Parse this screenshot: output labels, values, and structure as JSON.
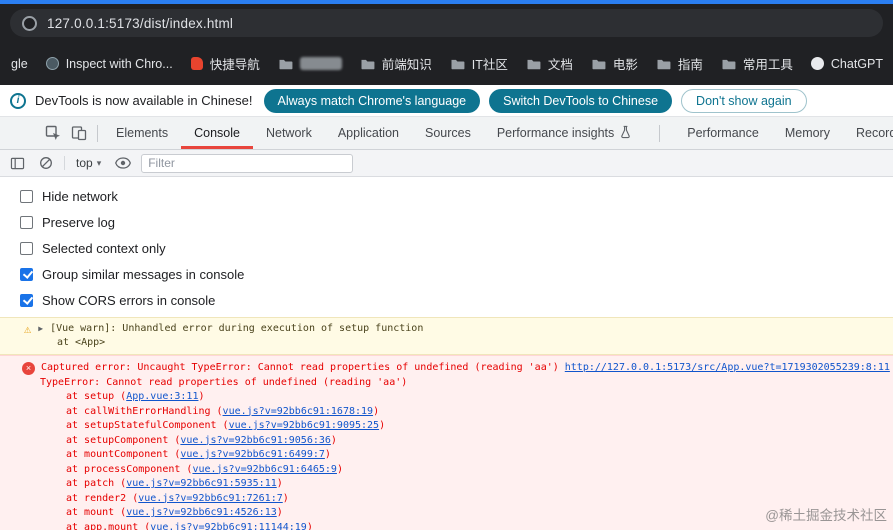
{
  "icons": {
    "warning": "⚠",
    "expander": "▶",
    "error_x": "×",
    "dropdown_arrow": "▾",
    "info": "i"
  },
  "browser": {
    "url": "127.0.0.1:5173/dist/index.html",
    "bookmarks": [
      {
        "label": "gle"
      },
      {
        "label": "Inspect with Chro..."
      },
      {
        "label": "快捷导航"
      },
      {
        "label": ""
      },
      {
        "label": "前端知识"
      },
      {
        "label": "IT社区"
      },
      {
        "label": "文档"
      },
      {
        "label": "电影"
      },
      {
        "label": "指南"
      },
      {
        "label": "常用工具"
      },
      {
        "label": "ChatGPT"
      }
    ]
  },
  "notice": {
    "message": "DevTools is now available in Chinese!",
    "primary_button": "Always match Chrome's language",
    "secondary_button": "Switch DevTools to Chinese",
    "dismiss_button": "Don't show again"
  },
  "devtools": {
    "tabs": [
      "Elements",
      "Console",
      "Network",
      "Application",
      "Sources",
      "Performance insights",
      "Performance",
      "Memory",
      "Recorder"
    ],
    "selected_tab": "Console",
    "toolbar": {
      "context_selector": "top",
      "filter_placeholder": "Filter"
    },
    "settings": [
      {
        "label": "Hide network",
        "checked": false
      },
      {
        "label": "Preserve log",
        "checked": false
      },
      {
        "label": "Selected context only",
        "checked": false
      },
      {
        "label": "Group similar messages in console",
        "checked": true
      },
      {
        "label": "Show CORS errors in console",
        "checked": true
      }
    ],
    "console": {
      "warning": {
        "line1": "[Vue warn]: Unhandled error during execution of setup function",
        "line2": "at <App>"
      },
      "error": {
        "message": "Captured error: Uncaught TypeError: Cannot read properties of undefined (reading 'aa')",
        "source_link": "http://127.0.0.1:5173/src/App.vue?t=1719302055239:8:11",
        "type_line": "TypeError: Cannot read properties of undefined (reading 'aa')",
        "stack": [
          {
            "prefix": "at setup (",
            "link": "App.vue:3:11",
            "suffix": ")"
          },
          {
            "prefix": "at callWithErrorHandling (",
            "link": "vue.js?v=92bb6c91:1678:19",
            "suffix": ")"
          },
          {
            "prefix": "at setupStatefulComponent (",
            "link": "vue.js?v=92bb6c91:9095:25",
            "suffix": ")"
          },
          {
            "prefix": "at setupComponent (",
            "link": "vue.js?v=92bb6c91:9056:36",
            "suffix": ")"
          },
          {
            "prefix": "at mountComponent (",
            "link": "vue.js?v=92bb6c91:6499:7",
            "suffix": ")"
          },
          {
            "prefix": "at processComponent (",
            "link": "vue.js?v=92bb6c91:6465:9",
            "suffix": ")"
          },
          {
            "prefix": "at patch (",
            "link": "vue.js?v=92bb6c91:5935:11",
            "suffix": ")"
          },
          {
            "prefix": "at render2 (",
            "link": "vue.js?v=92bb6c91:7261:7",
            "suffix": ")"
          },
          {
            "prefix": "at mount (",
            "link": "vue.js?v=92bb6c91:4526:13",
            "suffix": ")"
          },
          {
            "prefix": "at app.mount (",
            "link": "vue.js?v=92bb6c91:11144:19",
            "suffix": ")"
          }
        ]
      }
    }
  },
  "watermark": "@稀土掘金技术社区"
}
